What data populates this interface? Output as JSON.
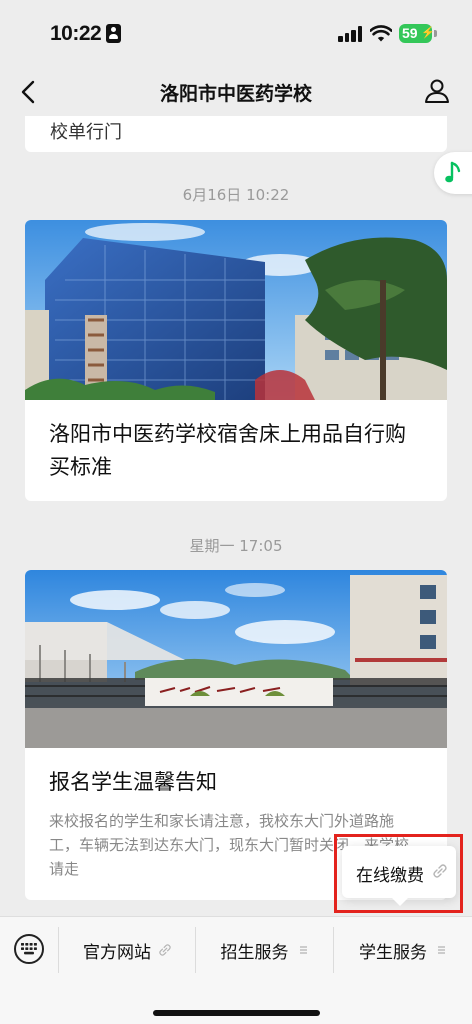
{
  "status_bar": {
    "time": "10:22",
    "battery": "59"
  },
  "nav": {
    "title": "洛阳市中医药学校"
  },
  "messages": [
    {
      "partial_title": "校单行门"
    },
    {
      "timestamp": "6月16日 10:22",
      "title": "洛阳市中医药学校宿舍床上用品自行购买标准"
    },
    {
      "timestamp": "星期一 17:05",
      "title": "报名学生温馨告知",
      "summary": "来校报名的学生和家长请注意，我校东大门外道路施工，车辆无法到达东大门，现东大门暂时关闭，来学校请走"
    }
  ],
  "popup": {
    "label": "在线缴费"
  },
  "bottom_menu": {
    "items": [
      {
        "label": "官方网站",
        "icon": "link-icon"
      },
      {
        "label": "招生服务",
        "icon": "submenu-icon"
      },
      {
        "label": "学生服务",
        "icon": "submenu-icon"
      }
    ]
  },
  "colors": {
    "highlight": "#e3231d",
    "battery": "#34c759",
    "music_accent": "#07c160",
    "background": "#ededed"
  }
}
